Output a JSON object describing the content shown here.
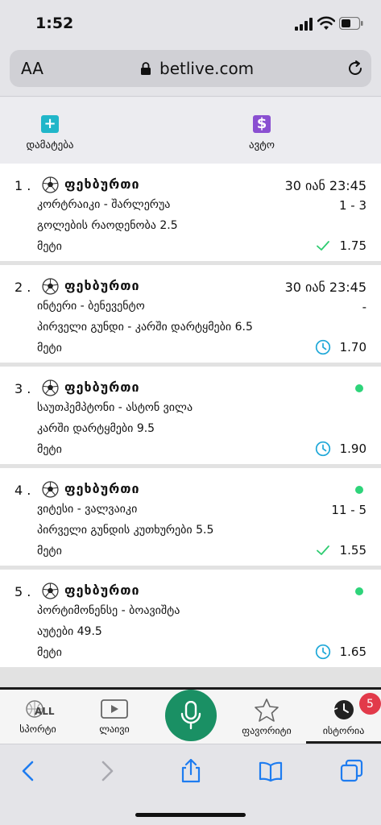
{
  "status_bar": {
    "time": "1:52"
  },
  "browser": {
    "url": "betlive.com",
    "text_size_label": "AA"
  },
  "toolbar": {
    "add_label": "დამატება",
    "auto_label": "ავტო"
  },
  "sport_label": "ფეხბურთი",
  "bets": [
    {
      "index": "1 .",
      "date": "30 იან 23:45",
      "match": "კორტრაიკი - შარლერუა",
      "score": "1 - 3",
      "market": "გოლების რაოდენობა 2.5",
      "outcome": "მეტი",
      "status": "won",
      "odds": "1.75"
    },
    {
      "index": "2 .",
      "date": "30 იან 23:45",
      "match": "ინტერი - ბენევენტო",
      "score": "-",
      "market": "პირველი გუნდი - კარში დარტყმები 6.5",
      "outcome": "მეტი",
      "status": "pending",
      "odds": "1.70"
    },
    {
      "index": "3 .",
      "date": "",
      "live": true,
      "match": "საუთჰემპტონი - ასტონ ვილა",
      "score": "",
      "market": "კარში დარტყმები 9.5",
      "outcome": "მეტი",
      "status": "pending",
      "odds": "1.90"
    },
    {
      "index": "4 .",
      "date": "",
      "live": true,
      "match": "ვიტესი - ვალვაიკი",
      "score": "11 - 5",
      "market": "პირველი გუნდის კუთხურები 5.5",
      "outcome": "მეტი",
      "status": "won",
      "odds": "1.55"
    },
    {
      "index": "5 .",
      "date": "",
      "live": true,
      "match": "პორტიმონენსე - ბოავიშტა",
      "score": "",
      "market": "აუტები 49.5",
      "outcome": "მეტი",
      "status": "pending",
      "odds": "1.65"
    }
  ],
  "bottom_nav": {
    "sports_label": "სპორტი",
    "sports_icon_text": "ALL",
    "live_label": "ლაივი",
    "favorites_label": "ფავორიტი",
    "history_label": "ისტორია",
    "history_badge": "5"
  },
  "colors": {
    "accent_green": "#1a9064",
    "won_green": "#2ecc71",
    "pending_blue": "#1fa8d8",
    "badge_red": "#e23a4a",
    "add_icon": "#21b6c9",
    "auto_icon": "#8a4fd1"
  }
}
